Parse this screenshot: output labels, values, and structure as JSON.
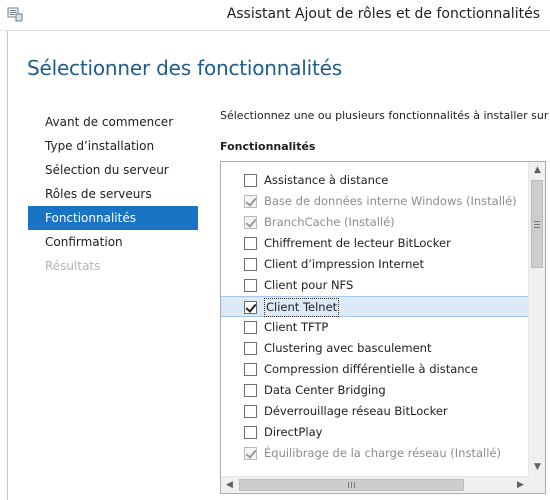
{
  "window": {
    "title": "Assistant Ajout de rôles et de fonctionnalités",
    "icon": "server-manager-icon"
  },
  "page": {
    "heading": "Sélectionner des fonctionnalités",
    "instruction": "Sélectionnez une ou plusieurs fonctionnalités à installer sur le serveur sélectionné.",
    "section_label": "Fonctionnalités"
  },
  "nav": {
    "items": [
      {
        "label": "Avant de commencer",
        "state": "normal"
      },
      {
        "label": "Type d’installation",
        "state": "normal"
      },
      {
        "label": "Sélection du serveur",
        "state": "normal"
      },
      {
        "label": "Rôles de serveurs",
        "state": "normal"
      },
      {
        "label": "Fonctionnalités",
        "state": "active"
      },
      {
        "label": "Confirmation",
        "state": "normal"
      },
      {
        "label": "Résultats",
        "state": "disabled"
      }
    ]
  },
  "features": [
    {
      "label": "Assistance à distance",
      "checked": false,
      "disabled": false,
      "selected": false
    },
    {
      "label": "Base de données interne Windows (Installé)",
      "checked": true,
      "disabled": true,
      "selected": false
    },
    {
      "label": "BranchCache (Installé)",
      "checked": true,
      "disabled": true,
      "selected": false
    },
    {
      "label": "Chiffrement de lecteur BitLocker",
      "checked": false,
      "disabled": false,
      "selected": false
    },
    {
      "label": "Client d’impression Internet",
      "checked": false,
      "disabled": false,
      "selected": false
    },
    {
      "label": "Client pour NFS",
      "checked": false,
      "disabled": false,
      "selected": false
    },
    {
      "label": "Client Telnet",
      "checked": true,
      "disabled": false,
      "selected": true
    },
    {
      "label": "Client TFTP",
      "checked": false,
      "disabled": false,
      "selected": false
    },
    {
      "label": "Clustering avec basculement",
      "checked": false,
      "disabled": false,
      "selected": false
    },
    {
      "label": "Compression différentielle à distance",
      "checked": false,
      "disabled": false,
      "selected": false
    },
    {
      "label": "Data Center Bridging",
      "checked": false,
      "disabled": false,
      "selected": false
    },
    {
      "label": "Déverrouillage réseau BitLocker",
      "checked": false,
      "disabled": false,
      "selected": false
    },
    {
      "label": "DirectPlay",
      "checked": false,
      "disabled": false,
      "selected": false
    },
    {
      "label": "Équilibrage de la charge réseau (Installé)",
      "checked": true,
      "disabled": true,
      "selected": false
    }
  ],
  "colors": {
    "accent": "#1a74c4",
    "heading": "#1f5c8b",
    "selection": "#dceaf8"
  }
}
